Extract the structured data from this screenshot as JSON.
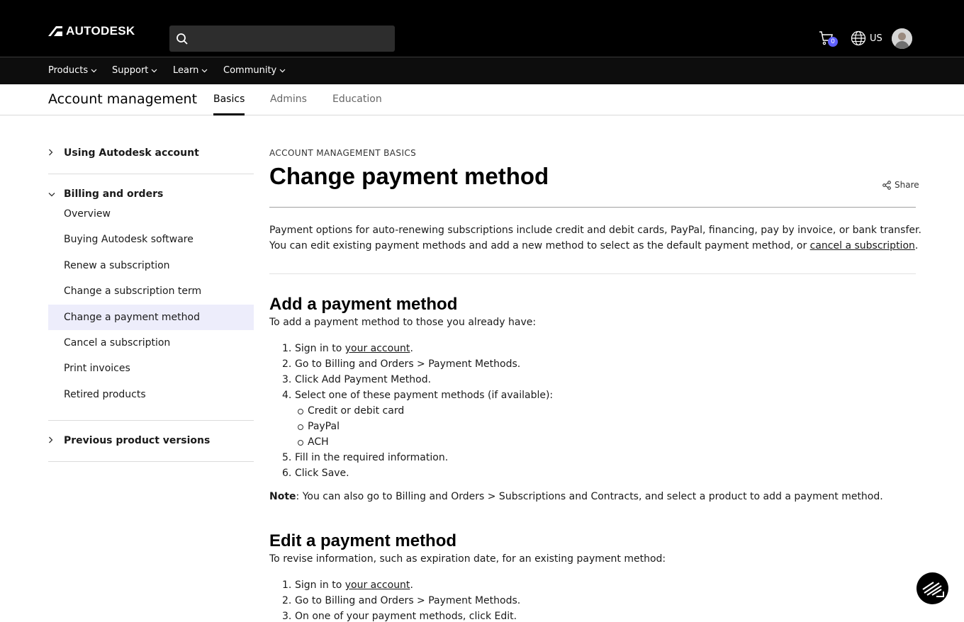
{
  "header": {
    "brand": "AUTODESK",
    "search_placeholder": "",
    "cart_count": "0",
    "region": "US"
  },
  "nav": [
    "Products",
    "Support",
    "Learn",
    "Community"
  ],
  "subheader": {
    "title": "Account management",
    "tabs": [
      "Basics",
      "Admins",
      "Education"
    ],
    "active_tab": "Basics"
  },
  "sidebar": {
    "sections": [
      "Using Autodesk account",
      "Billing and orders",
      "Previous product versions"
    ],
    "items": [
      "Overview",
      "Buying Autodesk software",
      "Renew a subscription",
      "Change a subscription term",
      "Change a payment method",
      "Cancel a subscription",
      "Print invoices",
      "Retired products"
    ],
    "active_item": "Change a payment method"
  },
  "article": {
    "eyebrow": "ACCOUNT MANAGEMENT BASICS",
    "title": "Change payment method",
    "share": "Share",
    "intro_line1": "Payment options for auto-renewing subscriptions include credit and debit cards, PayPal, financing, pay by invoice, or bank transfer.",
    "intro_line2_pre": "You can edit existing payment methods and add a new method to select as the default payment method, or ",
    "intro_link": "cancel a subscription",
    "intro_line2_post": ".",
    "add": {
      "heading": "Add a payment method",
      "lead": "To add a payment method to those you already have:",
      "steps": [
        {
          "num": "1.",
          "pre": "Sign in to ",
          "link": "your account",
          "post": "."
        },
        {
          "num": "2.",
          "text": "Go to Billing and Orders > Payment Methods."
        },
        {
          "num": "3.",
          "text": "Click Add Payment Method."
        },
        {
          "num": "4.",
          "text": "Select one of these payment methods (if available):"
        },
        {
          "num": "5.",
          "text": "Fill in the required information."
        },
        {
          "num": "6.",
          "text": "Click Save."
        }
      ],
      "options": [
        "Credit or debit card",
        "PayPal",
        "ACH"
      ]
    },
    "note_label": "Note",
    "note_text": ": You can also go to Billing and Orders > Subscriptions and Contracts, and select a product to add a payment method.",
    "edit": {
      "heading": "Edit a payment method",
      "lead": "To revise information, such as expiration date, for an existing payment method:",
      "steps": [
        {
          "num": "1.",
          "pre": "Sign in to ",
          "link": "your account",
          "post": "."
        },
        {
          "num": "2.",
          "text": "Go to Billing and Orders > Payment Methods."
        },
        {
          "num": "3.",
          "text": "On one of your payment methods, click Edit."
        }
      ]
    }
  }
}
